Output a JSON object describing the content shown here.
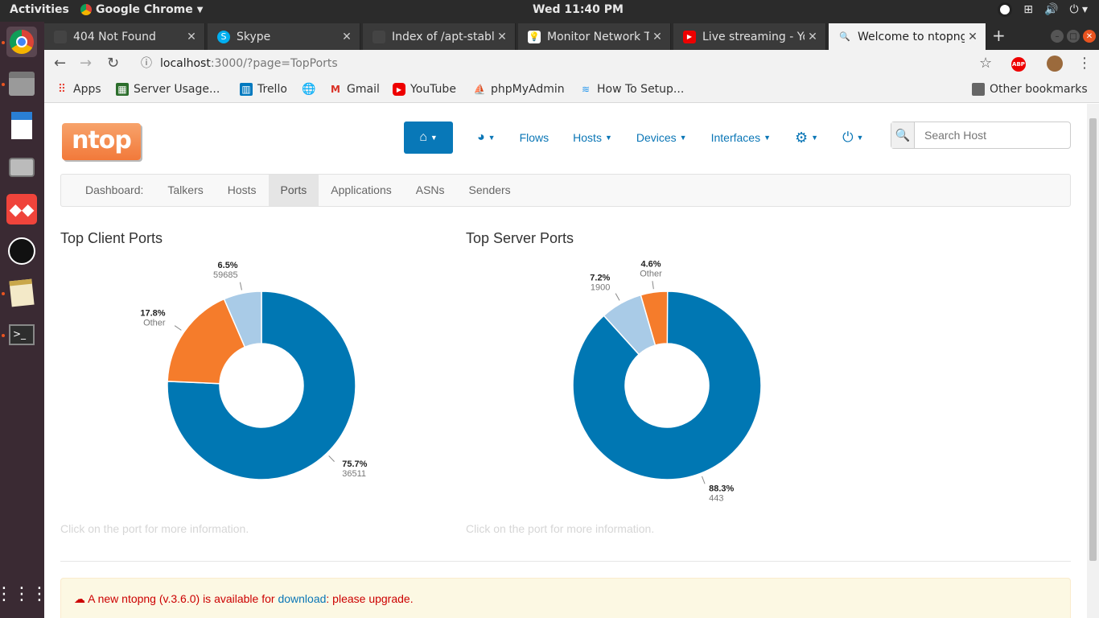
{
  "system": {
    "activities": "Activities",
    "app_menu": "Google Chrome",
    "clock": "Wed 11:40 PM"
  },
  "browser": {
    "tabs": [
      {
        "title": "404 Not Found",
        "icon": "blank-page-icon",
        "active": false
      },
      {
        "title": "Skype",
        "icon": "skype-icon",
        "active": false
      },
      {
        "title": "Index of /apt-stable",
        "icon": "blank-page-icon",
        "active": false
      },
      {
        "title": "Monitor Network T",
        "icon": "lightbulb-icon",
        "active": false
      },
      {
        "title": "Live streaming - Yo",
        "icon": "youtube-icon",
        "active": false
      },
      {
        "title": "Welcome to ntopng",
        "icon": "search-icon",
        "active": true
      }
    ],
    "url_host": "localhost",
    "url_path": ":3000/?page=TopPorts",
    "bookmarks": [
      {
        "label": "Apps",
        "icon": "apps-grid-icon"
      },
      {
        "label": "Server Usage...",
        "icon": "server-icon"
      },
      {
        "label": "Trello",
        "icon": "trello-icon"
      },
      {
        "label": "",
        "icon": "globe-icon"
      },
      {
        "label": "Gmail",
        "icon": "gmail-icon"
      },
      {
        "label": "YouTube",
        "icon": "youtube-icon"
      },
      {
        "label": "phpMyAdmin",
        "icon": "phpmyadmin-icon"
      },
      {
        "label": "How To Setup...",
        "icon": "docker-icon"
      }
    ],
    "other_bookmarks": "Other bookmarks"
  },
  "ntop": {
    "logo": "ntop",
    "nav": {
      "flows": "Flows",
      "hosts": "Hosts",
      "devices": "Devices",
      "interfaces": "Interfaces"
    },
    "search_placeholder": "Search Host",
    "subnav": {
      "label": "Dashboard:",
      "items": [
        "Talkers",
        "Hosts",
        "Ports",
        "Applications",
        "ASNs",
        "Senders"
      ],
      "active": "Ports"
    },
    "client_title": "Top Client Ports",
    "server_title": "Top Server Ports",
    "hint": "Click on the port for more information.",
    "alert": {
      "prefix": "A new ntopng (v.3.6.0) is available for ",
      "link": "download",
      "suffix": ": please upgrade."
    }
  },
  "chart_data": [
    {
      "type": "pie",
      "title": "Top Client Ports",
      "slices": [
        {
          "label": "36511",
          "percent": 75.7,
          "value_text": "75.7%",
          "color": "#0077b3"
        },
        {
          "label": "Other",
          "percent": 17.8,
          "value_text": "17.8%",
          "color": "#f57c2b"
        },
        {
          "label": "59685",
          "percent": 6.5,
          "value_text": "6.5%",
          "color": "#a9cbe7"
        }
      ]
    },
    {
      "type": "pie",
      "title": "Top Server Ports",
      "slices": [
        {
          "label": "443",
          "percent": 88.3,
          "value_text": "88.3%",
          "color": "#0077b3"
        },
        {
          "label": "1900",
          "percent": 7.2,
          "value_text": "7.2%",
          "color": "#a9cbe7"
        },
        {
          "label": "Other",
          "percent": 4.6,
          "value_text": "4.6%",
          "color": "#f57c2b"
        }
      ]
    }
  ]
}
